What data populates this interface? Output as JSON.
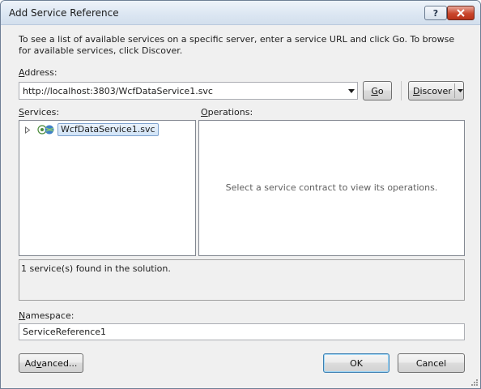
{
  "window": {
    "title": "Add Service Reference"
  },
  "instructions": "To see a list of available services on a specific server, enter a service URL and click Go. To browse for available services, click Discover.",
  "address": {
    "label_key": "A",
    "label_rest": "ddress:",
    "value": "http://localhost:3803/WcfDataService1.svc"
  },
  "buttons": {
    "go_key": "G",
    "go_rest": "o",
    "discover_key": "D",
    "discover_rest": "iscover",
    "advanced_pre": "Ad",
    "advanced_key": "v",
    "advanced_post": "anced...",
    "ok": "OK",
    "cancel": "Cancel"
  },
  "services": {
    "label_key": "S",
    "label_rest": "ervices:",
    "items": [
      {
        "label": "WcfDataService1.svc"
      }
    ]
  },
  "operations": {
    "label_key": "O",
    "label_rest": "perations:",
    "empty_text": "Select a service contract to view its operations."
  },
  "status": "1 service(s) found in the solution.",
  "namespace": {
    "label_key": "N",
    "label_rest": "amespace:",
    "value": "ServiceReference1"
  },
  "icons": {
    "help": "question-mark-icon",
    "close": "close-icon",
    "dropdown": "chevron-down-icon",
    "expand": "expand-triangle-icon",
    "service": "wcf-service-icon",
    "resize": "resize-grip-icon"
  },
  "colors": {
    "close_button": "#c9462c",
    "selection": "#d0e3f7",
    "default_button_border": "#3c7fb1"
  }
}
